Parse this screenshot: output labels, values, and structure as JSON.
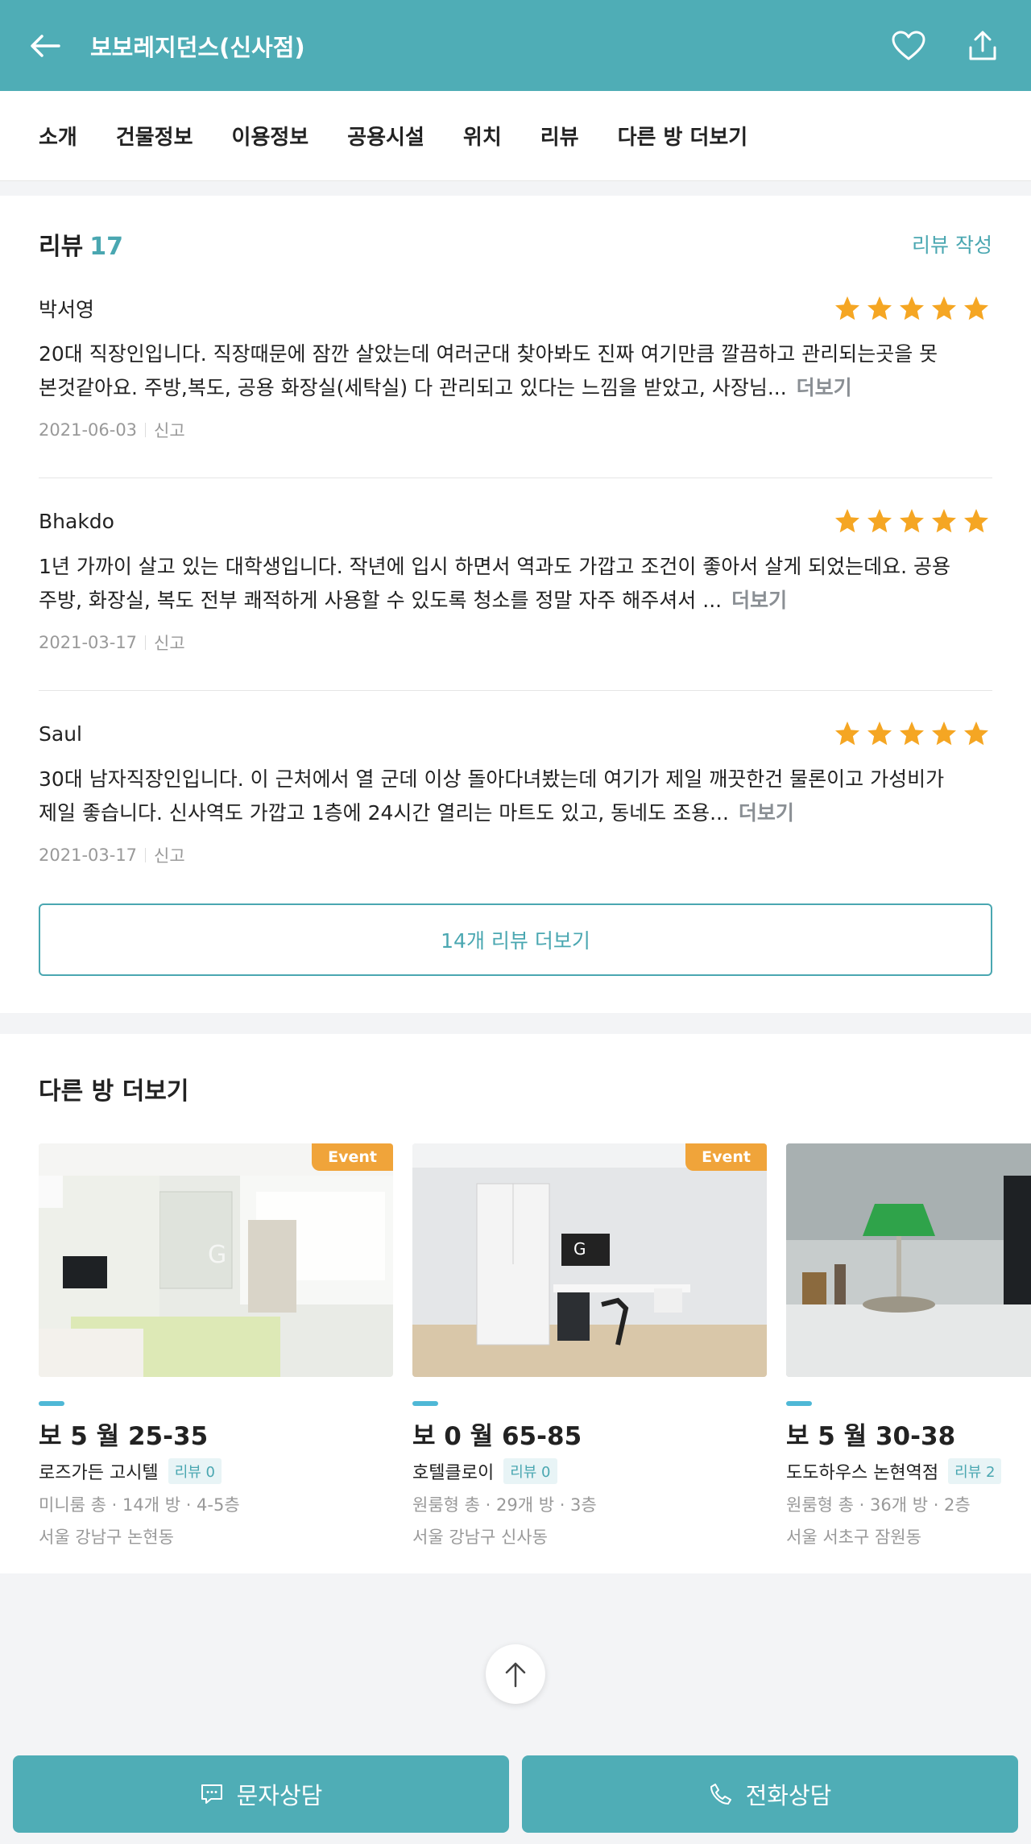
{
  "header": {
    "title": "보보레지던스(신사점)",
    "bg_color": "#4fadb6"
  },
  "tabs": [
    {
      "label": "소개"
    },
    {
      "label": "건물정보"
    },
    {
      "label": "이용정보"
    },
    {
      "label": "공용시설"
    },
    {
      "label": "위치"
    },
    {
      "label": "리뷰"
    },
    {
      "label": "다른 방 더보기"
    }
  ],
  "reviews": {
    "title": "리뷰",
    "count": "17",
    "write_label": "리뷰 작성",
    "more_label": "더보기",
    "report_label": "신고",
    "items": [
      {
        "author": "박서영",
        "rating": 5,
        "line1": "20대 직장인입니다. 직장때문에 잠깐 살았는데 여러군대 찾아봐도 진짜 여기만큼 깔끔하고 관리되는곳을 못",
        "line2": "본것같아요. 주방,복도, 공용 화장실(세탁실) 다 관리되고 있다는 느낌을 받았고, 사장님...",
        "date": "2021-06-03"
      },
      {
        "author": "Bhakdo",
        "rating": 5,
        "line1": "1년 가까이 살고 있는 대학생입니다. 작년에 입시 하면서 역과도 가깝고 조건이 좋아서 살게 되었는데요. 공용",
        "line2": "주방, 화장실, 복도 전부 쾌적하게 사용할 수 있도록 청소를 정말 자주 해주셔서 ...",
        "date": "2021-03-17"
      },
      {
        "author": "Saul",
        "rating": 5,
        "line1": "30대 남자직장인입니다. 이 근처에서 열 군데 이상 돌아다녀봤는데 여기가 제일 깨끗한건 물론이고 가성비가",
        "line2": "제일 좋습니다. 신사역도 가깝고 1층에 24시간 열리는 마트도 있고, 동네도 조용...",
        "date": "2021-03-17"
      }
    ],
    "more_reviews_button": "14개 리뷰 더보기"
  },
  "other_rooms": {
    "title": "다른 방 더보기",
    "event_label": "Event",
    "items": [
      {
        "price": "보 5  월 25-35",
        "name": "로즈가든 고시텔",
        "review_badge": "리뷰 0",
        "info": "미니룸 총 · 14개 방 · 4-5층",
        "location": "서울 강남구 논현동",
        "event": true
      },
      {
        "price": "보 0  월 65-85",
        "name": "호텔클로이",
        "review_badge": "리뷰 0",
        "info": "원룸형 총 · 29개 방 · 3층",
        "location": "서울 강남구 신사동",
        "event": true
      },
      {
        "price": "보 5  월 30-38",
        "name": "도도하우스 논현역점",
        "review_badge": "리뷰 2",
        "info": "원룸형 총 · 36개 방 · 2층",
        "location": "서울 서초구 잠원동",
        "event": false
      }
    ]
  },
  "footer": {
    "sms_label": "문자상담",
    "call_label": "전화상담"
  },
  "colors": {
    "accent": "#4aa7b1",
    "star": "#f5a623",
    "event": "#f0a43a"
  }
}
